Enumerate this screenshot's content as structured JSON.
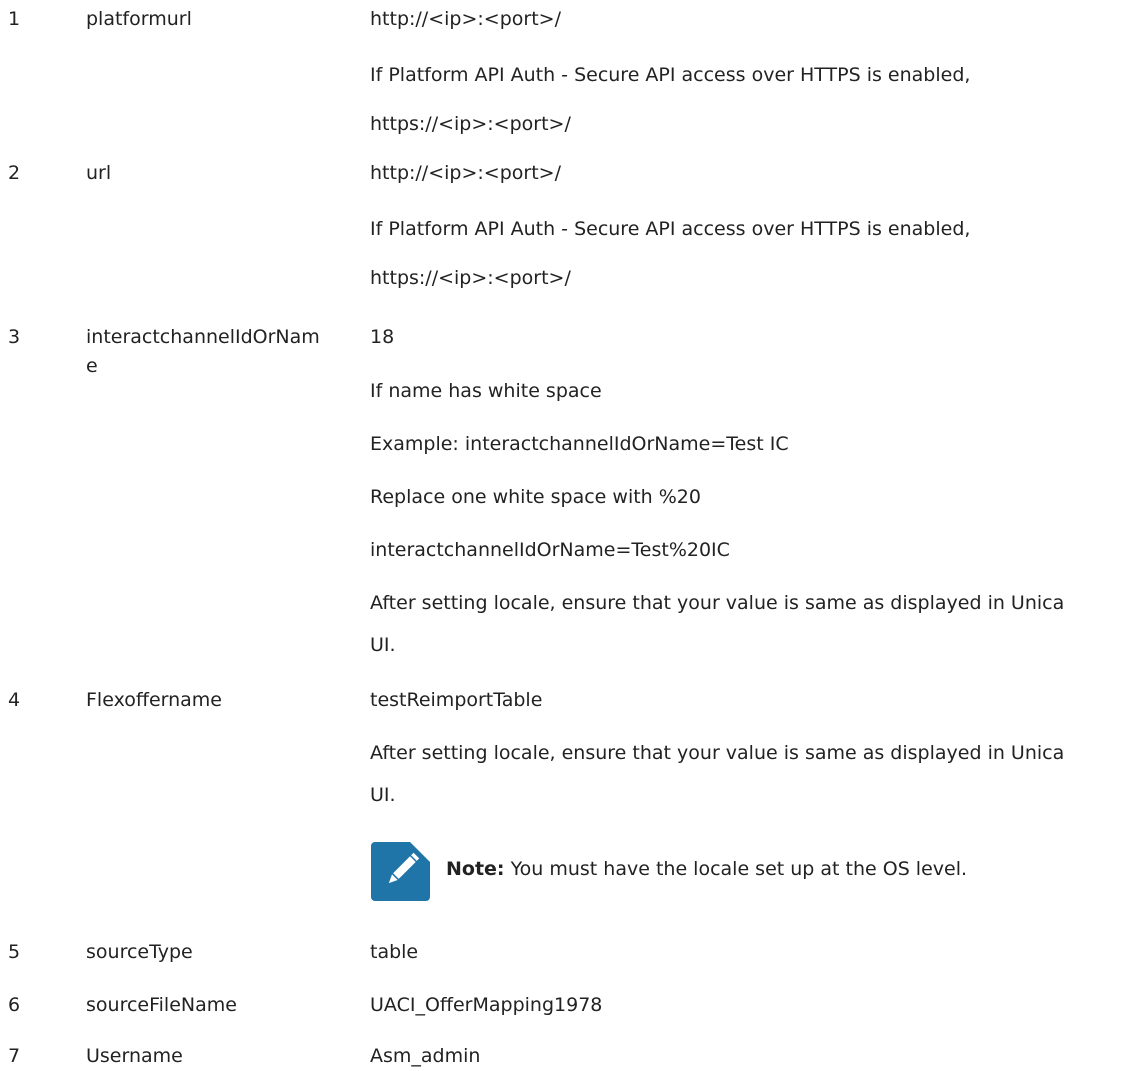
{
  "rows": [
    {
      "num": "1",
      "param": "platformurl",
      "lines": [
        "http://<ip>:<port>/",
        "If Platform API Auth - Secure API access over HTTPS is enabled,",
        "https://<ip>:<port>/"
      ]
    },
    {
      "num": "2",
      "param": "url",
      "lines": [
        "http://<ip>:<port>/",
        "If Platform API Auth - Secure API access over HTTPS is enabled,",
        "https://<ip>:<port>/"
      ]
    },
    {
      "num": "3",
      "param": "interactchannelIdOrNam",
      "param_wrap": "e",
      "lines": [
        "18",
        "If name has white space",
        "Example: interactchannelIdOrName=Test IC",
        "Replace one white space with %20",
        "interactchannelIdOrName=Test%20IC",
        "After setting locale, ensure that your value is same as displayed in Unica",
        "UI."
      ]
    },
    {
      "num": "4",
      "param": "Flexoffername",
      "lines": [
        "testReimportTable",
        "After setting locale, ensure that your value is same as displayed in Unica",
        "UI."
      ],
      "note": {
        "icon": "pencil-note-icon",
        "label": "Note:",
        "text": " You must have the locale set up at the OS level.",
        "icon_color": "#1f74a8"
      }
    },
    {
      "num": "5",
      "param": "sourceType",
      "lines": [
        "table"
      ]
    },
    {
      "num": "6",
      "param": "sourceFileName",
      "lines": [
        "UACI_OfferMapping1978"
      ]
    },
    {
      "num": "7",
      "param": "Username",
      "lines": [
        "Asm_admin"
      ]
    }
  ]
}
